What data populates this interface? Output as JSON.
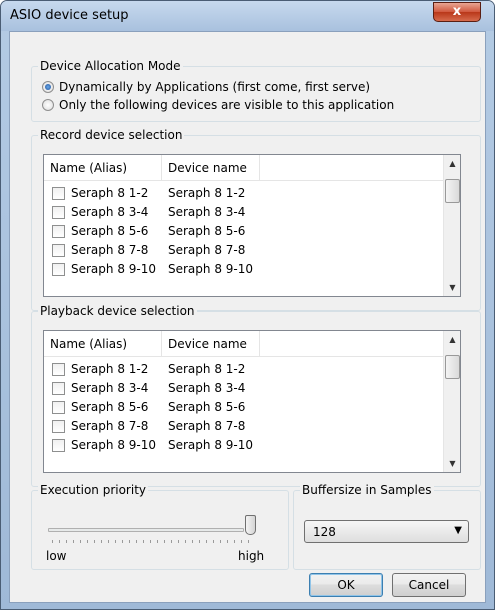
{
  "window": {
    "title": "ASIO device setup",
    "close_label": "x"
  },
  "allocation": {
    "legend": "Device Allocation Mode",
    "options": [
      {
        "label": "Dynamically by Applications (first come, first serve)",
        "checked": true
      },
      {
        "label": "Only the following devices are visible to this application",
        "checked": false
      }
    ]
  },
  "record": {
    "legend": "Record device selection",
    "columns": [
      "Name (Alias)",
      "Device name"
    ],
    "rows": [
      {
        "alias": "Seraph 8 1-2",
        "device": "Seraph 8 1-2"
      },
      {
        "alias": "Seraph 8 3-4",
        "device": "Seraph 8 3-4"
      },
      {
        "alias": "Seraph 8 5-6",
        "device": "Seraph 8 5-6"
      },
      {
        "alias": "Seraph 8 7-8",
        "device": "Seraph 8 7-8"
      },
      {
        "alias": "Seraph 8 9-10",
        "device": "Seraph 8 9-10"
      }
    ]
  },
  "playback": {
    "legend": "Playback device selection",
    "columns": [
      "Name (Alias)",
      "Device name"
    ],
    "rows": [
      {
        "alias": "Seraph 8 1-2",
        "device": "Seraph 8 1-2"
      },
      {
        "alias": "Seraph 8 3-4",
        "device": "Seraph 8 3-4"
      },
      {
        "alias": "Seraph 8 5-6",
        "device": "Seraph 8 5-6"
      },
      {
        "alias": "Seraph 8 7-8",
        "device": "Seraph 8 7-8"
      },
      {
        "alias": "Seraph 8 9-10",
        "device": "Seraph 8 9-10"
      }
    ]
  },
  "priority": {
    "legend": "Execution priority",
    "low": "low",
    "high": "high",
    "level": 1.0
  },
  "buffer": {
    "legend": "Buffersize in Samples",
    "value": "128"
  },
  "buttons": {
    "ok": "OK",
    "cancel": "Cancel"
  },
  "icons": {
    "close": "close-icon",
    "dropdown": "chevron-down-icon",
    "scroll_up": "scroll-up-arrow-icon",
    "scroll_down": "scroll-down-arrow-icon"
  },
  "colors": {
    "title_bar": "#b4cbe4",
    "close_button": "#c7472b",
    "dialog_bg": "#f0f0f0"
  }
}
